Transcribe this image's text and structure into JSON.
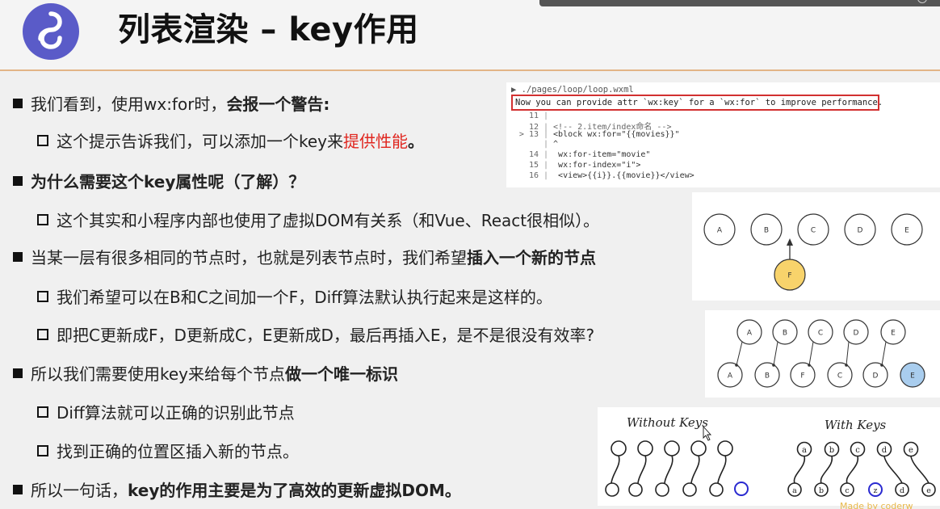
{
  "header": {
    "title": "列表渲染 – key作用",
    "logo_icon": "mini-program-icon"
  },
  "bullets": [
    {
      "level": 1,
      "parts": [
        {
          "t": "我们看到，使用wx:for时，"
        },
        {
          "t": "会报一个警告:",
          "b": true
        }
      ]
    },
    {
      "level": 2,
      "parts": [
        {
          "t": "这个提示告诉我们，可以添加一个key来"
        },
        {
          "t": "提供性能",
          "red": true
        },
        {
          "t": "。",
          "b": true
        }
      ]
    },
    {
      "level": 1,
      "parts": [
        {
          "t": "为什么需要这个key属性呢（了解）？",
          "b": true
        }
      ]
    },
    {
      "level": 2,
      "parts": [
        {
          "t": "这个其实和小程序内部也使用了虚拟DOM有关系（和Vue、React很相似）。"
        }
      ]
    },
    {
      "level": 1,
      "parts": [
        {
          "t": "当某一层有很多相同的节点时，也就是列表节点时，我们希望"
        },
        {
          "t": "插入一个新的节点",
          "b": true
        }
      ]
    },
    {
      "level": 2,
      "parts": [
        {
          "t": "我们希望可以在B和C之间加一个F，Diff算法默认执行起来是这样的。"
        }
      ]
    },
    {
      "level": 2,
      "parts": [
        {
          "t": "即把C更新成F，D更新成C，E更新成D，最后再插入E，是不是很没有效率?"
        }
      ]
    },
    {
      "level": 1,
      "parts": [
        {
          "t": "所以我们需要使用key来给每个节点"
        },
        {
          "t": "做一个唯一标识",
          "b": true
        }
      ]
    },
    {
      "level": 2,
      "parts": [
        {
          "t": "Diff算法就可以正确的识别此节点"
        }
      ]
    },
    {
      "level": 2,
      "parts": [
        {
          "t": "找到正确的位置区插入新的节点。"
        }
      ]
    },
    {
      "level": 1,
      "parts": [
        {
          "t": "所以一句话，"
        },
        {
          "t": "key的作用主要是为了高效的更新虚拟DOM。",
          "b": true
        }
      ]
    }
  ],
  "code": {
    "path": "▶ ./pages/loop/loop.wxml",
    "warning": "Now you can provide attr `wx:key` for a `wx:for` to improve performance.",
    "lines": [
      {
        "ln": "11",
        "text": ""
      },
      {
        "ln": "12",
        "text": "<!-- 2.item/index命名 -->"
      },
      {
        "ln": "> 13",
        "text": "<block wx:for=\"{{movies}}\""
      },
      {
        "ln": "",
        "text": "^"
      },
      {
        "ln": "14",
        "text": "      wx:for-item=\"movie\""
      },
      {
        "ln": "15",
        "text": "      wx:for-index=\"i\">"
      },
      {
        "ln": "16",
        "text": "  <view>{{i}}.{{movie}}</view>"
      }
    ]
  },
  "diagram1": {
    "nodes": [
      "A",
      "B",
      "C",
      "D",
      "E"
    ],
    "inserted": "F",
    "inserted_color": "#f8d36b"
  },
  "diagram2": {
    "top": [
      "A",
      "B",
      "C",
      "D",
      "E"
    ],
    "bottom": [
      "A",
      "B",
      "F",
      "C",
      "D",
      "E"
    ],
    "new_color": "#a9cdee"
  },
  "diagram3": {
    "left_label": "Without Keys",
    "right_label": "With Keys",
    "right_top": [
      "a",
      "b",
      "c",
      "d",
      "e"
    ],
    "right_bottom": [
      "a",
      "b",
      "c",
      "z",
      "d",
      "e"
    ],
    "new_color": "#2a2ad0"
  },
  "footer": "Made by coderw"
}
